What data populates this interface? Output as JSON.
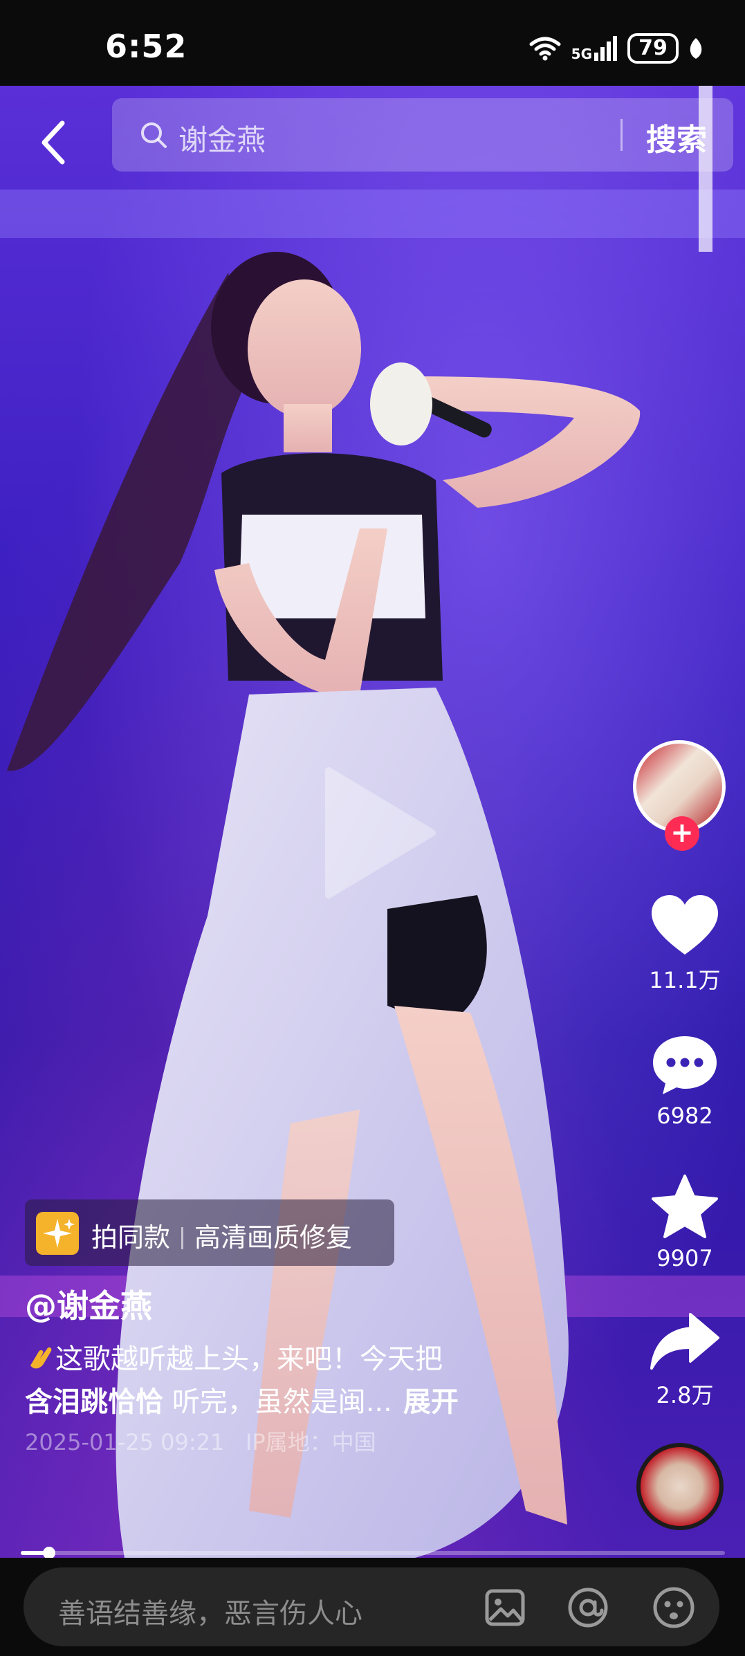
{
  "status_bar": {
    "time": "6:52",
    "network": "5G",
    "battery": "79"
  },
  "search": {
    "query": "谢金燕",
    "button": "搜索"
  },
  "rail": {
    "likes": "11.1万",
    "comments": "6982",
    "favorites": "9907",
    "shares": "2.8万"
  },
  "chip": {
    "same_style": "拍同款",
    "enhance": "高清画质修复"
  },
  "post": {
    "author": "@谢金燕",
    "line1": "这歌越听越上头，来吧！今天把",
    "hashtag": "含泪跳恰恰",
    "line2_rest": " 听完，虽然是闽...",
    "expand": "展开",
    "date": "2025-01-25 09:21",
    "ip_label": "IP属地：",
    "ip_value": "中国"
  },
  "playback": {
    "progress": 0.04
  },
  "comment_bar": {
    "placeholder": "善语结善缘，恶言伤人心"
  },
  "colors": {
    "accent": "#fe2c55",
    "chip_icon": "#f5b32b",
    "bg": "#0b0b0b"
  }
}
